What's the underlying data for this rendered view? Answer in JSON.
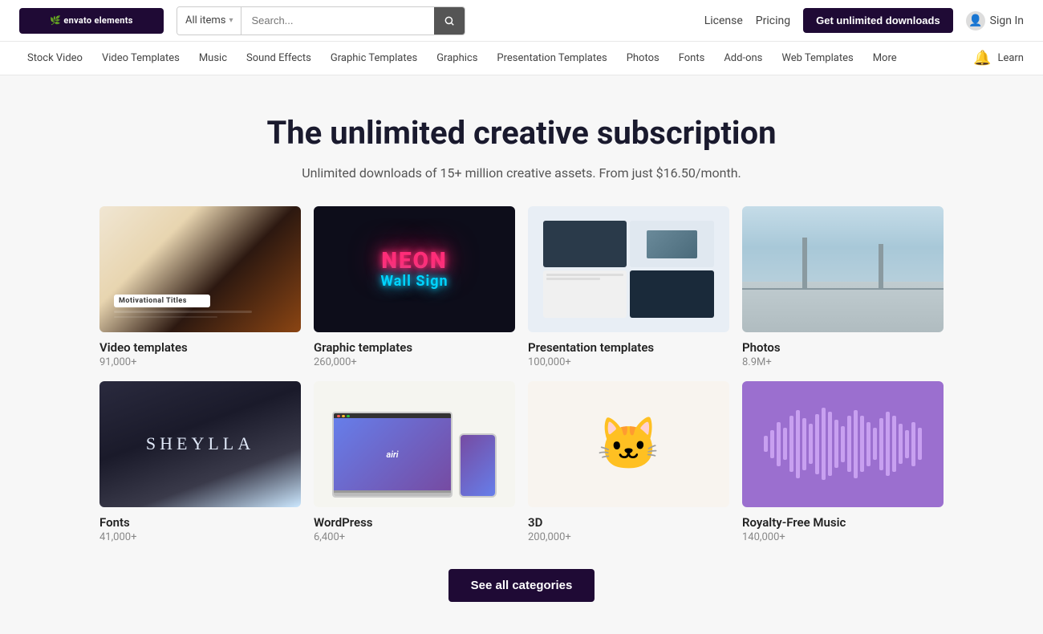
{
  "logo": {
    "text": "envato elements",
    "icon": "🌿"
  },
  "search": {
    "dropdown_label": "All items",
    "placeholder": "Search..."
  },
  "top_nav": {
    "license": "License",
    "pricing": "Pricing",
    "get_btn": "Get unlimited downloads",
    "sign_in": "Sign In"
  },
  "second_nav": {
    "items": [
      "Stock Video",
      "Video Templates",
      "Music",
      "Sound Effects",
      "Graphic Templates",
      "Graphics",
      "Presentation Templates",
      "Photos",
      "Fonts",
      "Add-ons",
      "Web Templates",
      "More"
    ],
    "learn": "Learn"
  },
  "hero": {
    "title": "The unlimited creative subscription",
    "subtitle": "Unlimited downloads of 15+ million creative assets. From just $16.50/month."
  },
  "categories": [
    {
      "id": "video-templates",
      "name": "Video templates",
      "count": "91,000+",
      "card_type": "video"
    },
    {
      "id": "graphic-templates",
      "name": "Graphic templates",
      "count": "260,000+",
      "card_type": "graphic"
    },
    {
      "id": "presentation-templates",
      "name": "Presentation templates",
      "count": "100,000+",
      "card_type": "presentation"
    },
    {
      "id": "photos",
      "name": "Photos",
      "count": "8.9M+",
      "card_type": "photos"
    },
    {
      "id": "fonts",
      "name": "Fonts",
      "count": "41,000+",
      "card_type": "fonts"
    },
    {
      "id": "wordpress",
      "name": "WordPress",
      "count": "6,400+",
      "card_type": "wordpress"
    },
    {
      "id": "3d",
      "name": "3D",
      "count": "200,000+",
      "card_type": "3d"
    },
    {
      "id": "royalty-free-music",
      "name": "Royalty-Free Music",
      "count": "140,000+",
      "card_type": "music"
    }
  ],
  "see_all_btn": "See all categories",
  "neon": {
    "line1": "NEON",
    "line2": "Wall Sign"
  },
  "font_card": {
    "text": "SHEYLLA"
  },
  "wp_card": {
    "text": "airi"
  },
  "motivational": {
    "text": "Motivational Titles"
  },
  "wave_heights": [
    20,
    35,
    55,
    40,
    70,
    85,
    65,
    50,
    75,
    90,
    80,
    60,
    45,
    70,
    85,
    70,
    55,
    40,
    65,
    80,
    70,
    50,
    35,
    55,
    40
  ]
}
